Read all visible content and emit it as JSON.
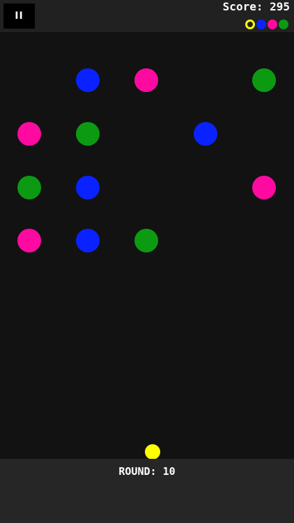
{
  "header": {
    "pause_label": "II",
    "score_text": "Score: 295"
  },
  "colors": {
    "yellow": "#ffff00",
    "blue": "#0a22ff",
    "pink": "#ff0aa0",
    "green": "#0c9a12",
    "board_bg": "#121212",
    "bar_bg": "#212121"
  },
  "palette": [
    "yellow",
    "blue",
    "pink",
    "green"
  ],
  "palette_current": "yellow",
  "grid": {
    "columns": 5,
    "rows": 4,
    "cells": [
      [
        "",
        "blue",
        "pink",
        "",
        "green"
      ],
      [
        "pink",
        "green",
        "",
        "blue",
        ""
      ],
      [
        "green",
        "blue",
        "",
        "",
        "pink"
      ],
      [
        "pink",
        "blue",
        "green",
        "",
        ""
      ]
    ]
  },
  "player": {
    "color": "yellow"
  },
  "footer": {
    "round_text": "ROUND: 10"
  }
}
